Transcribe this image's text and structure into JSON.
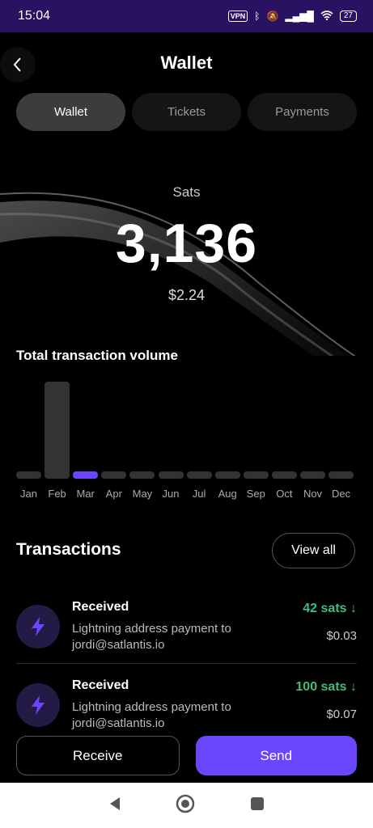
{
  "status": {
    "time": "15:04",
    "vpn": "VPN",
    "battery": "27"
  },
  "header": {
    "title": "Wallet"
  },
  "tabs": [
    {
      "label": "Wallet",
      "active": true
    },
    {
      "label": "Tickets",
      "active": false
    },
    {
      "label": "Payments",
      "active": false
    }
  ],
  "balance": {
    "label": "Sats",
    "value": "3,136",
    "fiat": "$2.24"
  },
  "volume": {
    "title": "Total transaction volume"
  },
  "chart_data": {
    "type": "bar",
    "categories": [
      "Jan",
      "Feb",
      "Mar",
      "Apr",
      "May",
      "Jun",
      "Jul",
      "Aug",
      "Sep",
      "Oct",
      "Nov",
      "Dec"
    ],
    "values": [
      0,
      100,
      3,
      0,
      0,
      0,
      0,
      0,
      0,
      0,
      0,
      0
    ],
    "highlight": "Mar",
    "colors": {
      "bar": "#333333",
      "highlight": "#6a47ff"
    }
  },
  "transactions": {
    "title": "Transactions",
    "view_all": "View all",
    "items": [
      {
        "type": "Received",
        "desc1": "Lightning address payment to",
        "desc2": "jordi@satlantis.io",
        "amount": "42 sats ↓",
        "fiat": "$0.03"
      },
      {
        "type": "Received",
        "desc1": "Lightning address payment to",
        "desc2": "jordi@satlantis.io",
        "amount": "100 sats ↓",
        "fiat": "$0.07"
      }
    ]
  },
  "actions": {
    "receive": "Receive",
    "send": "Send"
  },
  "icons": {
    "back": "chevron-left-icon",
    "tx": "lightning-icon",
    "nav": [
      "back-triangle-icon",
      "home-circle-icon",
      "recents-square-icon"
    ]
  }
}
